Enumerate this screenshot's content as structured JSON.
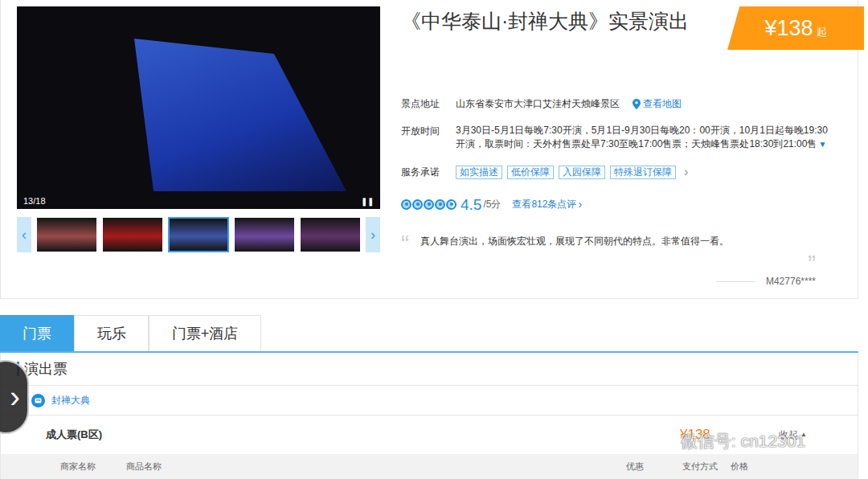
{
  "gallery": {
    "counter": "13/18",
    "pause_icon": "❚❚",
    "prev_icon": "‹",
    "next_icon": "›",
    "thumbnails": [
      {
        "selected": false,
        "color": "#9a4a4a"
      },
      {
        "selected": false,
        "color": "#a81a1a"
      },
      {
        "selected": true,
        "color": "#3e56a8"
      },
      {
        "selected": false,
        "color": "#6e48a0"
      },
      {
        "selected": false,
        "color": "#5e3468"
      }
    ]
  },
  "title": "《中华泰山·封禅大典》实景演出",
  "price": {
    "amount": "¥138",
    "suffix": "起"
  },
  "address": {
    "label": "景点地址",
    "value": "山东省泰安市大津口艾洼村天烛峰景区",
    "link": "查看地图"
  },
  "hours": {
    "label": "开放时间",
    "lines": [
      "3月30日-5月1日每晚7:30开演，5月1日-9月30日每晚20：00开演，10月1日起每晚19:30",
      "开演，取票时间：天外村售票处早7:30至晚17:00售票；天烛峰售票处18:30到21:00售"
    ],
    "expand_icon": "▼"
  },
  "services": {
    "label": "服务承诺",
    "tags": [
      "如实描述",
      "低价保障",
      "入园保障",
      "特殊退订保障"
    ],
    "more_icon": "›"
  },
  "rating": {
    "stars": 4.5,
    "score": "4.5",
    "scale": "/5分",
    "reviews_link": "查看812条点评",
    "reviews_icon": "›"
  },
  "review": {
    "open_quote": "“",
    "text": "真人舞台演出，场面恢宏壮观，展现了不同朝代的特点。非常值得一看。",
    "close_quote": "”",
    "author": "M42776****"
  },
  "tabs": [
    {
      "label": "门票",
      "selected": true
    },
    {
      "label": "玩乐",
      "selected": false
    },
    {
      "label": "门票+酒店",
      "selected": false
    }
  ],
  "section": {
    "title": "演出票",
    "category": "封禅大典",
    "ticket": {
      "name": "成人票(B区)",
      "price": "¥138",
      "toggle": "收起",
      "toggle_icon": "▲"
    }
  },
  "table": {
    "columns": [
      "商家名称",
      "商品名称",
      "优惠",
      "支付方式",
      "价格"
    ]
  },
  "watermark": "微信号: cn12301",
  "side_button_icon": "›"
}
